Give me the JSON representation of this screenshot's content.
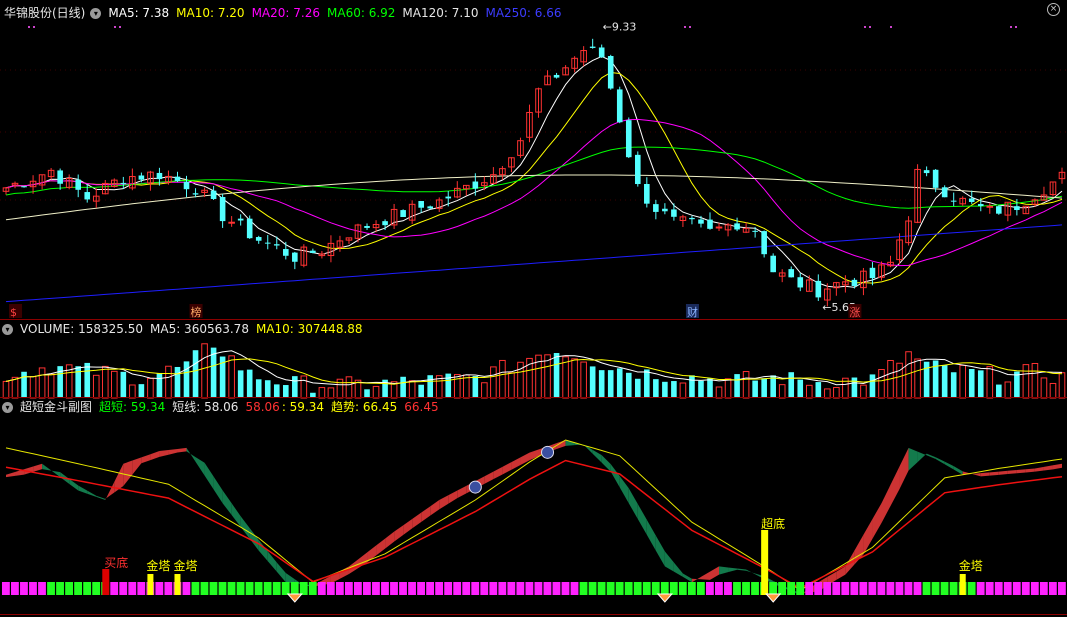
{
  "colors": {
    "background": "#000000",
    "candle_up": "#ff3232",
    "candle_down": "#54ffff",
    "ma5": "#ffffff",
    "ma10": "#ffff00",
    "ma20": "#ff00ff",
    "ma60": "#00ff00",
    "ma120": "#f0f0c8",
    "ma250": "#1e1eff",
    "panel_border": "#8b0000",
    "band_up": "#cc3333",
    "band_down": "#137a4c",
    "slow_line": "#e6e600",
    "fast_line": "#ee1111",
    "strip_a": "#ff22ff",
    "strip_b": "#22ff22",
    "signal_red": "#dd0000",
    "signal_yellow": "#ffff00"
  },
  "main_panel": {
    "title": "华锦股份(日线)",
    "ma": [
      {
        "label": "MA5: 7.38",
        "color": "#ffffff"
      },
      {
        "label": "MA10: 7.20",
        "color": "#ffff00"
      },
      {
        "label": "MA20: 7.26",
        "color": "#ff00ff"
      },
      {
        "label": "MA60: 6.92",
        "color": "#00ff00"
      },
      {
        "label": "MA120: 7.10",
        "color": "#e6e6e6"
      },
      {
        "label": "MA250: 6.66",
        "color": "#1e1eff"
      }
    ],
    "high_label": "9.33",
    "low_label": "5.65",
    "markers": [
      "$",
      "榜",
      "财",
      "涨"
    ]
  },
  "volume_panel": {
    "labels": [
      {
        "text": "VOLUME: 158325.50",
        "color": "#e6e6e6"
      },
      {
        "text": "MA5: 360563.78",
        "color": "#e6e6e6"
      },
      {
        "text": "MA10: 307448.88",
        "color": "#ffff00"
      }
    ]
  },
  "indicator_panel": {
    "title": "超短金斗副图",
    "labels": [
      {
        "text": "超短: 59.34",
        "color": "#00ff00"
      },
      {
        "text": "短线: 58.06",
        "color": "#e6e6e6"
      },
      {
        "text": "58.06",
        "color": "#ff3232"
      },
      {
        "text": ": 59.34",
        "color": "#ffff00"
      },
      {
        "text": "趋势: 66.45",
        "color": "#ffff00"
      },
      {
        "text": "66.45",
        "color": "#ff3232"
      }
    ],
    "signals": {
      "buy_bottom": "买底",
      "gold_tower": "金塔",
      "super_bottom": "超底"
    }
  },
  "controls": {
    "collapse_symbol": "▾",
    "close_symbol": "×"
  },
  "chart_data": {
    "type": "candlestick",
    "price_range": [
      5.4,
      9.6
    ],
    "x_count": 118,
    "anchors": [
      [
        0,
        7.2
      ],
      [
        5,
        7.45
      ],
      [
        9,
        7.05
      ],
      [
        13,
        7.35
      ],
      [
        17,
        7.4
      ],
      [
        21,
        7.2
      ],
      [
        24,
        6.8
      ],
      [
        28,
        6.45
      ],
      [
        32,
        6.2
      ],
      [
        35,
        6.3
      ],
      [
        38,
        6.55
      ],
      [
        42,
        6.75
      ],
      [
        48,
        7.0
      ],
      [
        54,
        7.4
      ],
      [
        57,
        7.9
      ],
      [
        59,
        8.6
      ],
      [
        62,
        8.95
      ],
      [
        64,
        9.2
      ],
      [
        66,
        9.1
      ],
      [
        68,
        8.2
      ],
      [
        70,
        7.2
      ],
      [
        72,
        6.9
      ],
      [
        74,
        6.7
      ],
      [
        76,
        6.65
      ],
      [
        78,
        6.55
      ],
      [
        81,
        6.7
      ],
      [
        83,
        6.6
      ],
      [
        85,
        6.0
      ],
      [
        87,
        5.85
      ],
      [
        90,
        5.72
      ],
      [
        93,
        5.85
      ],
      [
        96,
        5.9
      ],
      [
        98,
        6.1
      ],
      [
        100,
        6.8
      ],
      [
        101,
        7.4
      ],
      [
        103,
        7.25
      ],
      [
        106,
        7.0
      ],
      [
        109,
        6.85
      ],
      [
        112,
        6.95
      ],
      [
        115,
        7.2
      ],
      [
        117,
        7.35
      ]
    ],
    "volume_anchors": [
      [
        0,
        0.4
      ],
      [
        5,
        0.55
      ],
      [
        10,
        0.45
      ],
      [
        15,
        0.35
      ],
      [
        20,
        0.55
      ],
      [
        23,
        0.95
      ],
      [
        27,
        0.4
      ],
      [
        32,
        0.25
      ],
      [
        38,
        0.22
      ],
      [
        45,
        0.28
      ],
      [
        52,
        0.35
      ],
      [
        56,
        0.55
      ],
      [
        60,
        0.85
      ],
      [
        64,
        0.72
      ],
      [
        66,
        0.58
      ],
      [
        70,
        0.45
      ],
      [
        75,
        0.38
      ],
      [
        80,
        0.3
      ],
      [
        85,
        0.35
      ],
      [
        90,
        0.28
      ],
      [
        96,
        0.32
      ],
      [
        100,
        0.75
      ],
      [
        102,
        0.55
      ],
      [
        106,
        0.45
      ],
      [
        110,
        0.38
      ],
      [
        114,
        0.45
      ],
      [
        117,
        0.35
      ]
    ],
    "osc_anchors": [
      [
        0,
        0.78
      ],
      [
        4,
        0.85
      ],
      [
        8,
        0.68
      ],
      [
        11,
        0.62
      ],
      [
        13,
        0.85
      ],
      [
        17,
        0.93
      ],
      [
        20,
        0.95
      ],
      [
        24,
        0.6
      ],
      [
        28,
        0.3
      ],
      [
        31,
        0.1
      ],
      [
        34,
        0.08
      ],
      [
        38,
        0.2
      ],
      [
        43,
        0.42
      ],
      [
        48,
        0.62
      ],
      [
        54,
        0.8
      ],
      [
        58,
        0.92
      ],
      [
        62,
        1.0
      ],
      [
        64,
        0.97
      ],
      [
        67,
        0.8
      ],
      [
        70,
        0.5
      ],
      [
        73,
        0.2
      ],
      [
        76,
        0.1
      ],
      [
        79,
        0.2
      ],
      [
        82,
        0.18
      ],
      [
        85,
        0.09
      ],
      [
        88,
        0.02
      ],
      [
        90,
        0.1
      ],
      [
        93,
        0.2
      ],
      [
        97,
        0.6
      ],
      [
        100,
        0.95
      ],
      [
        103,
        0.88
      ],
      [
        106,
        0.78
      ],
      [
        110,
        0.8
      ],
      [
        114,
        0.82
      ],
      [
        117,
        0.85
      ]
    ],
    "trend_anchors": [
      [
        0,
        0.95
      ],
      [
        8,
        0.85
      ],
      [
        18,
        0.72
      ],
      [
        28,
        0.38
      ],
      [
        34,
        0.1
      ],
      [
        42,
        0.28
      ],
      [
        52,
        0.62
      ],
      [
        58,
        0.86
      ],
      [
        62,
        1.0
      ],
      [
        68,
        0.9
      ],
      [
        76,
        0.48
      ],
      [
        84,
        0.2
      ],
      [
        88,
        0.05
      ],
      [
        96,
        0.32
      ],
      [
        104,
        0.76
      ],
      [
        110,
        0.82
      ],
      [
        117,
        0.88
      ]
    ],
    "buy_bottom_index": 11,
    "gold_tower_indices": [
      16,
      19,
      106
    ],
    "super_bottom_index": 84,
    "cup_indices": [
      52,
      60
    ],
    "diamond_indices": [
      32,
      73,
      85
    ],
    "marker_indices": [
      1,
      21,
      76,
      94
    ]
  }
}
